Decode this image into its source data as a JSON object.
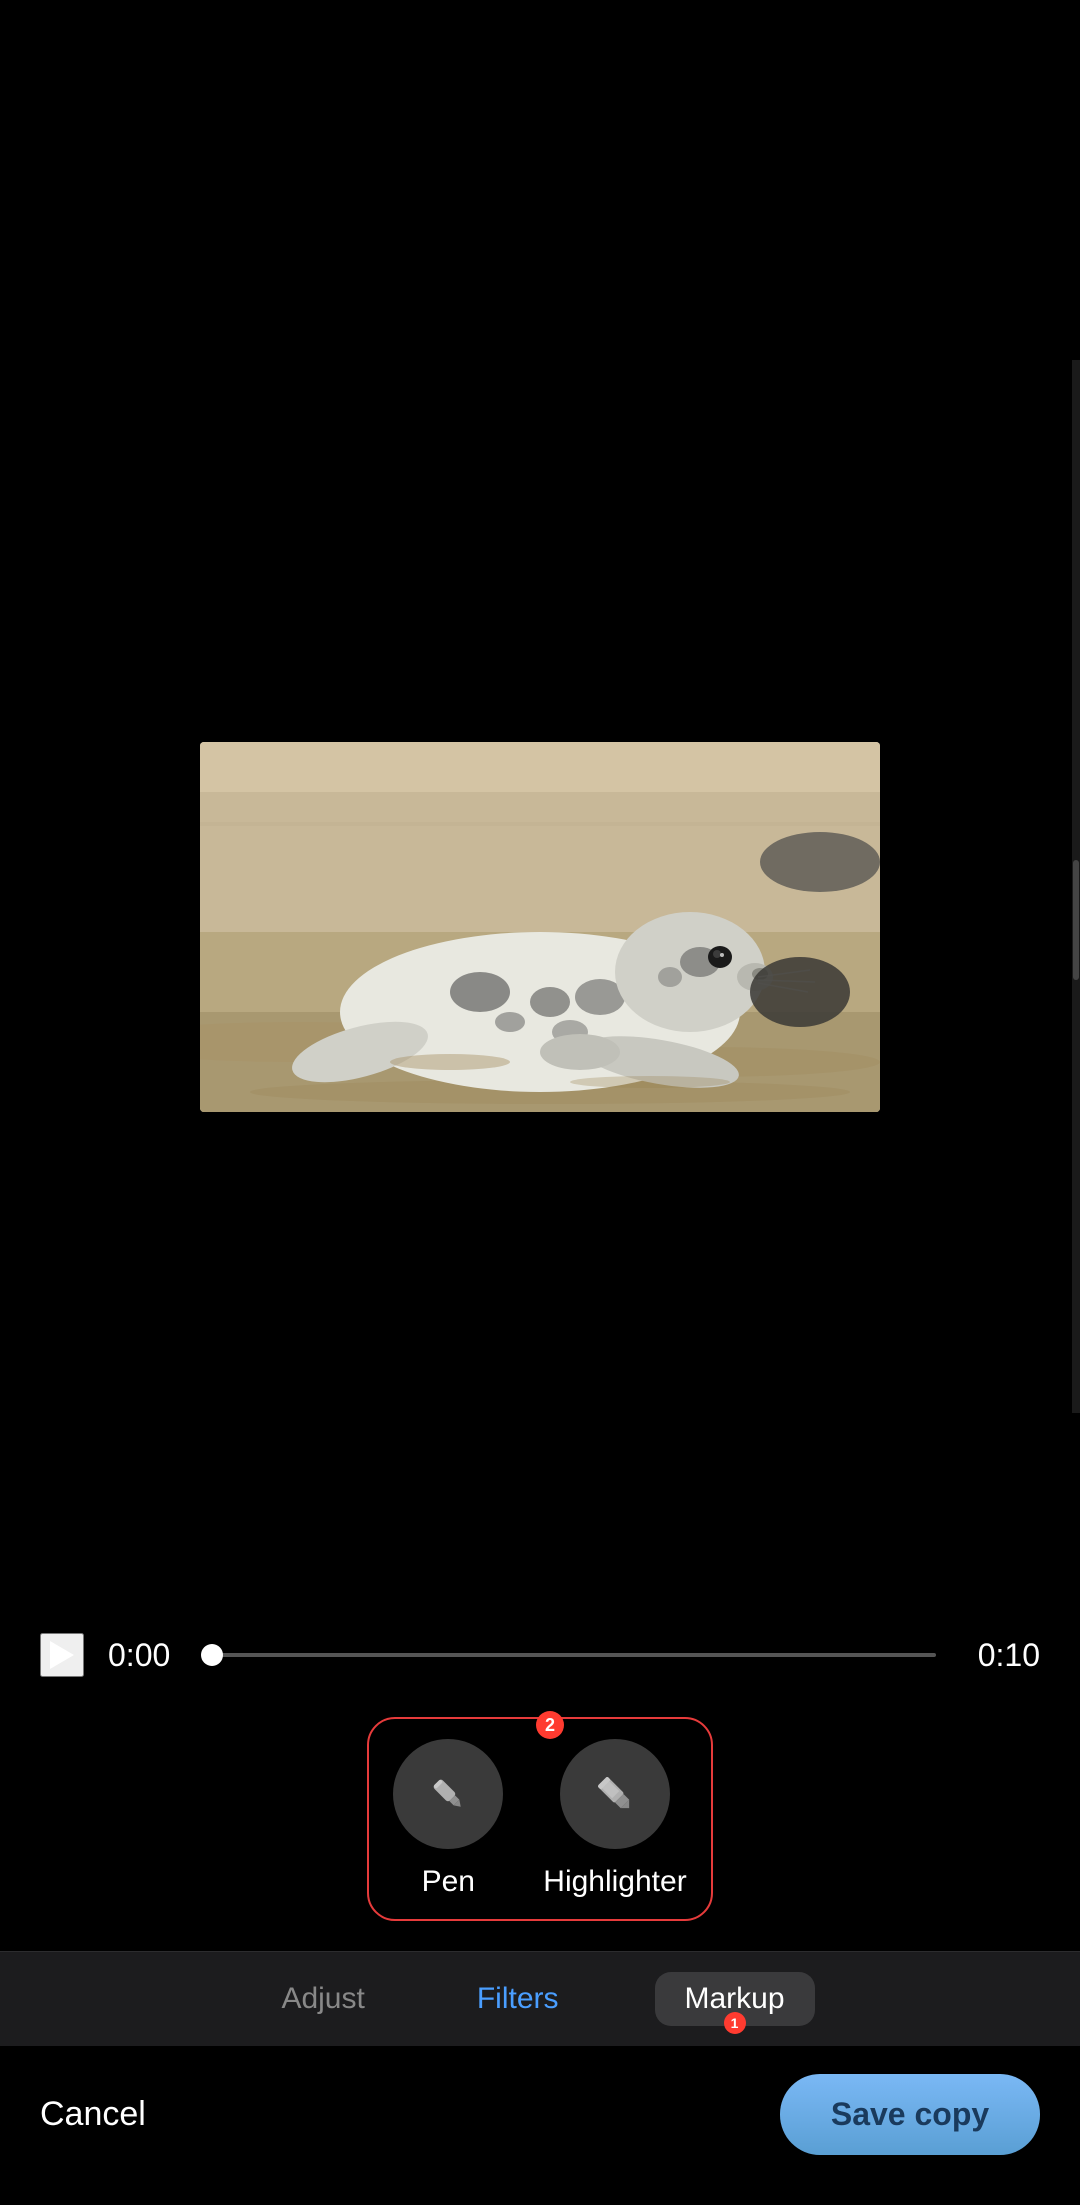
{
  "video": {
    "time_current": "0:00",
    "time_total": "0:10",
    "progress_percent": 0
  },
  "tools": {
    "badge_count": "2",
    "pen": {
      "label": "Pen"
    },
    "highlighter": {
      "label": "Highlighter"
    }
  },
  "tabs": {
    "adjust": {
      "label": "Adjust"
    },
    "filters": {
      "label": "Filters"
    },
    "markup": {
      "label": "Markup",
      "active": true,
      "badge": "1"
    }
  },
  "actions": {
    "cancel": "Cancel",
    "save_copy": "Save copy"
  },
  "image": {
    "alt": "Seal on beach"
  }
}
